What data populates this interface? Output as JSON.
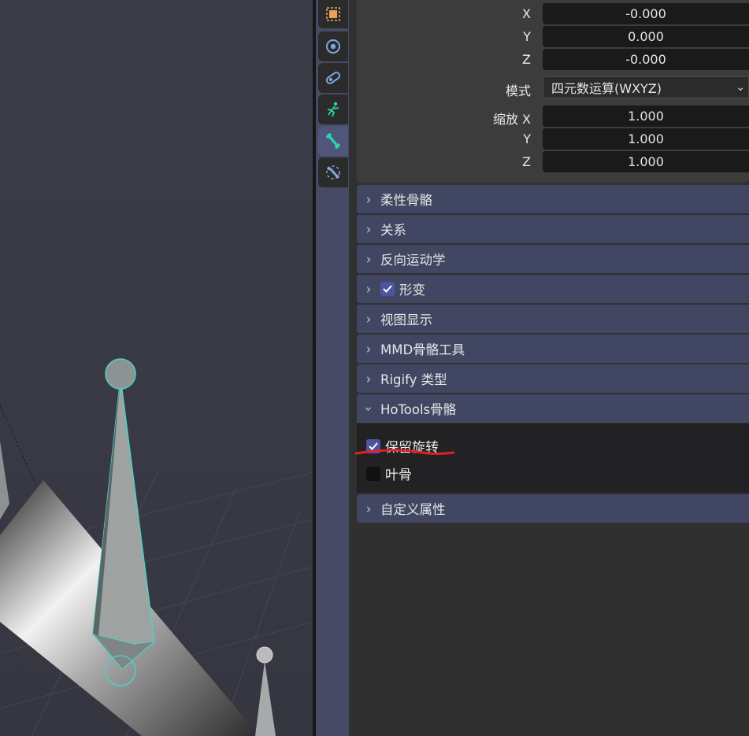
{
  "transform": {
    "rot_x_label": "X",
    "rot_x": "-0.000",
    "rot_y_label": "Y",
    "rot_y": "0.000",
    "rot_z_label": "Z",
    "rot_z": "-0.000",
    "mode_label": "模式",
    "mode_value": "四元数运算(WXYZ)",
    "scale_x_label": "缩放 X",
    "scale_x": "1.000",
    "scale_y_label": "Y",
    "scale_y": "1.000",
    "scale_z_label": "Z",
    "scale_z": "1.000"
  },
  "panels": {
    "bendy_bones": "柔性骨骼",
    "relations": "关系",
    "inverse_kinematics": "反向运动学",
    "deform": "形变",
    "viewport_display": "视图显示",
    "mmd_bone_tools": "MMD骨骼工具",
    "rigify_type": "Rigify 类型",
    "hotools_bone": "HoTools骨骼",
    "custom_properties": "自定义属性"
  },
  "hotools": {
    "keep_rotation_label": "保留旋转",
    "keep_rotation_checked": true,
    "leaf_bone_label": "叶骨",
    "leaf_bone_checked": false
  },
  "tabs": [
    "object-tab",
    "physics-tab",
    "constraints-tab",
    "object-data-armature-tab",
    "bone-tab",
    "bone-constraints-tab"
  ],
  "colors": {
    "accent": "#4c56a0",
    "selection": "#4fd1c5",
    "annotation": "#e0202a"
  }
}
